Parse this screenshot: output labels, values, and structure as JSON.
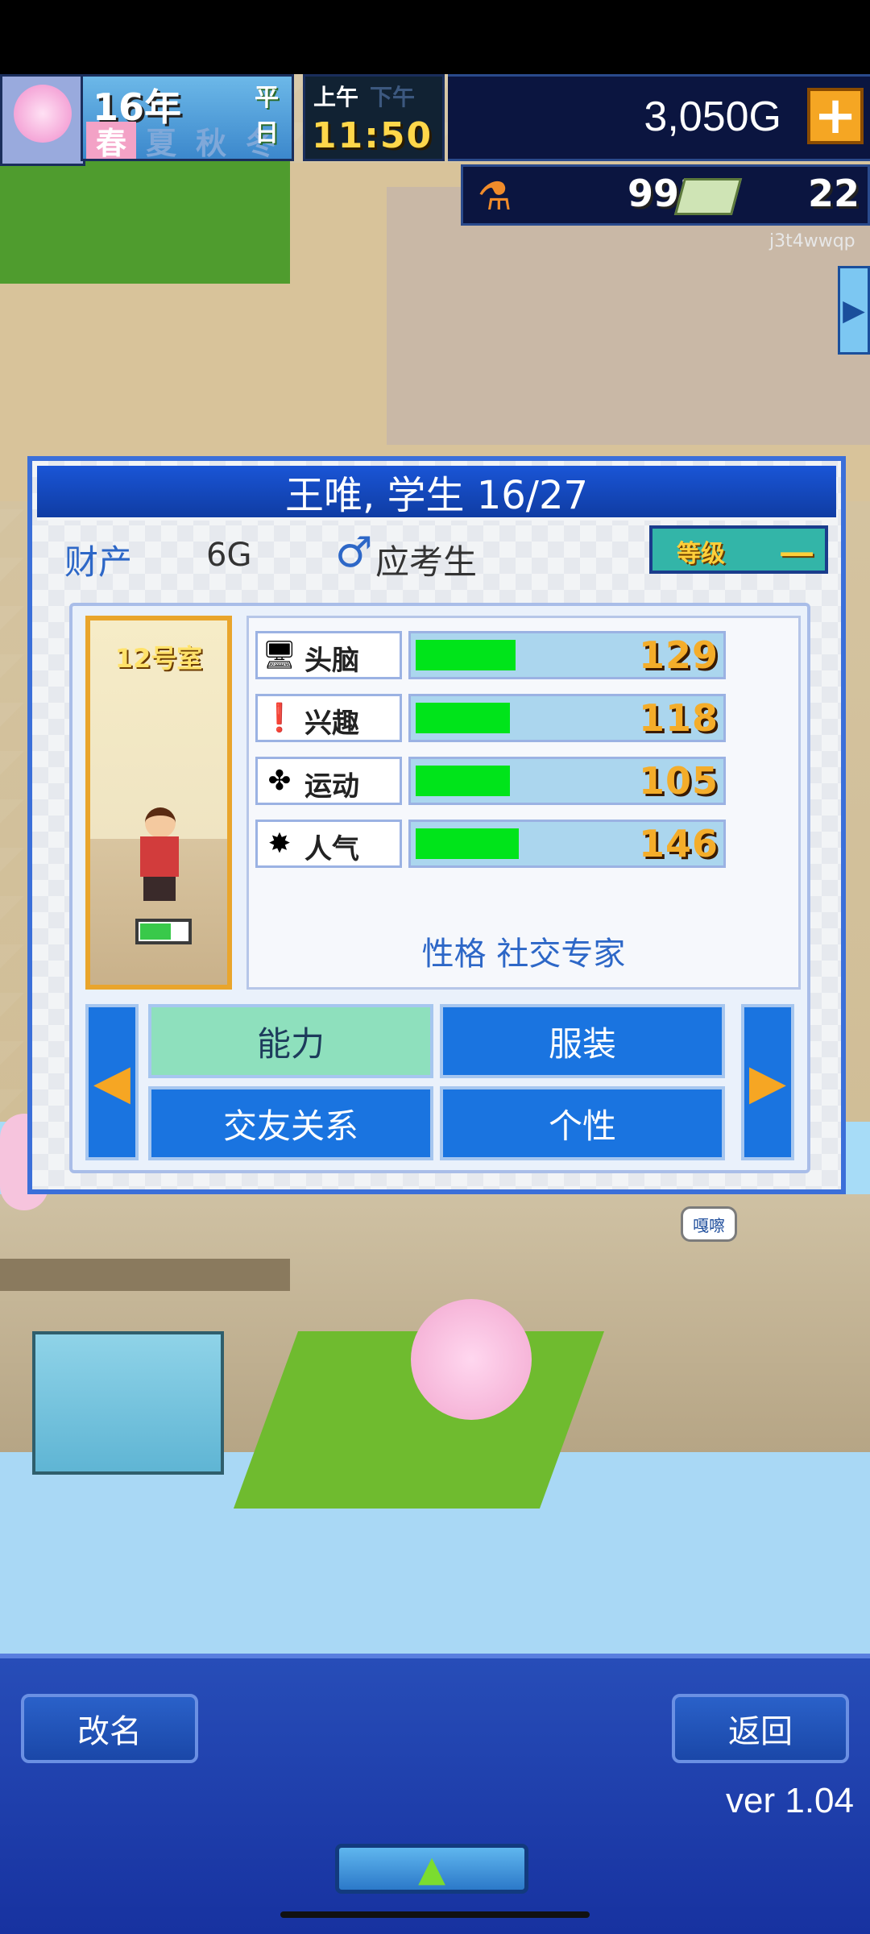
{
  "hud": {
    "year": "16年",
    "day_type": "平日",
    "seasons": [
      "春",
      "夏",
      "秋",
      "冬"
    ],
    "active_season": "春",
    "ampm": [
      "上午",
      "下午"
    ],
    "time": "11:50",
    "money": "3,050G",
    "research_points": "993",
    "cash_count": "22",
    "watermark": "j3t4wwqp"
  },
  "panel": {
    "title": "王唯, 学生 16/27",
    "asset_label": "财产",
    "asset_value": "6G",
    "status": "应考生",
    "level_label": "等级",
    "level_value": "一",
    "room": "12号室",
    "stats": [
      {
        "name": "头脑",
        "value": "129",
        "fill": 0.33,
        "icon": "brain-icon"
      },
      {
        "name": "兴趣",
        "value": "118",
        "fill": 0.31,
        "icon": "interest-icon"
      },
      {
        "name": "运动",
        "value": "105",
        "fill": 0.31,
        "icon": "sports-icon"
      },
      {
        "name": "人气",
        "value": "146",
        "fill": 0.34,
        "icon": "popularity-icon"
      }
    ],
    "personality": "性格 社交专家",
    "tabs": [
      {
        "label": "能力",
        "active": true
      },
      {
        "label": "服装",
        "active": false
      },
      {
        "label": "交友关系",
        "active": false
      },
      {
        "label": "个性",
        "active": false
      }
    ]
  },
  "world": {
    "bubble_text": "嘎嚓"
  },
  "bottom": {
    "rename_label": "改名",
    "back_label": "返回",
    "version": "ver 1.04"
  },
  "colors": {
    "panel_border": "#3b6fd9",
    "tab_active": "#8ee0bd",
    "tab_inactive": "#1a74e0",
    "stat_fill": "#00e41a",
    "stat_value": "#f4ad2a"
  }
}
